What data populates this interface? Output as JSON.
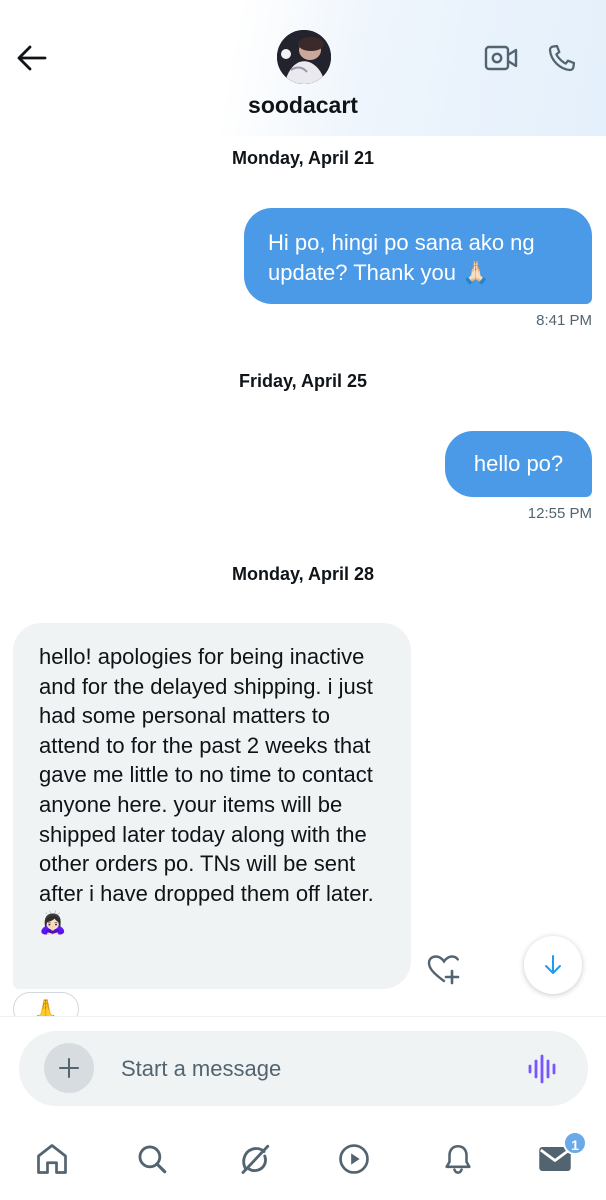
{
  "conversation": {
    "username": "soodacart",
    "messages": [
      {
        "date": "Monday, April 21",
        "direction": "outgoing",
        "text": "Hi po, hingi po sana ako ng update? Thank you 🙏🏻",
        "time": "8:41 PM"
      },
      {
        "date": "Friday, April 25",
        "direction": "outgoing",
        "text": "hello po?",
        "time": "12:55 PM"
      },
      {
        "date": "Monday, April 28",
        "direction": "incoming",
        "text": "hello! apologies for being inactive and for the delayed shipping. i just had some personal matters to attend to for the past 2 weeks that gave me little to no time to contact anyone here. your items will be shipped later today along with the other orders po. TNs will be sent after i have dropped them off later. 🙇🏻‍♀️",
        "reaction": "🙏"
      }
    ]
  },
  "composer": {
    "placeholder": "Start a message"
  },
  "nav": {
    "items": [
      "home-icon",
      "search-icon",
      "grok-icon",
      "video-icon",
      "notifications-icon",
      "messages-icon"
    ],
    "messages_badge": "1"
  },
  "colors": {
    "accent": "#1d9bf0",
    "outgoing_bubble": "#4a9ae8",
    "incoming_bubble": "#eff3f4",
    "voice_icon": "#7856ff"
  }
}
